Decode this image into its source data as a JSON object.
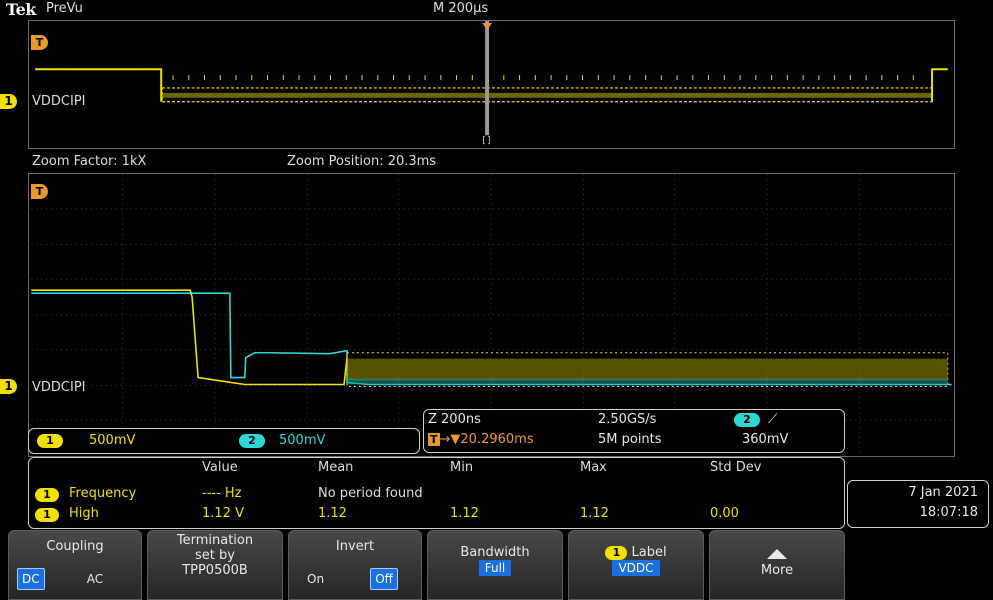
{
  "header": {
    "brand": "Tek",
    "mode": "PreVu",
    "timebase": "M 200µs"
  },
  "overview": {
    "trigger_marker": "T",
    "channel_number": "1",
    "channel_label": "VDDCIPI",
    "zoom_box_marker": "[]"
  },
  "zoom_info": {
    "factor": "Zoom Factor: 1kX",
    "position": "Zoom Position: 20.3ms"
  },
  "zoom_window": {
    "trigger_marker": "T",
    "channel_number": "1",
    "channel_label": "VDDCIPI"
  },
  "channels": {
    "ch1_num": "1",
    "ch1_scale": "500mV",
    "ch2_num": "2",
    "ch2_scale": "500mV"
  },
  "acquisition": {
    "zoom_time": "Z 200ns",
    "sample_rate": "2.50GS/s",
    "trig_channel": "2",
    "trig_slope": "⟋",
    "trig_marker": "T",
    "trig_arrow": "→▼",
    "trig_position": "20.2960ms",
    "record_length": "5M points",
    "trig_level": "360mV"
  },
  "measurements": {
    "headers": [
      "Value",
      "Mean",
      "Min",
      "Max",
      "Std Dev"
    ],
    "rows": [
      {
        "ch": "1",
        "name": "Frequency",
        "value": "---- Hz",
        "mean": "No period found",
        "min": "",
        "max": "",
        "std": ""
      },
      {
        "ch": "1",
        "name": "High",
        "value": "1.12 V",
        "mean": "1.12",
        "min": "1.12",
        "max": "1.12",
        "std": "0.00"
      }
    ]
  },
  "datetime": {
    "date": "7 Jan  2021",
    "time": "18:07:18"
  },
  "menu": {
    "coupling": {
      "label": "Coupling",
      "opt_a": "DC",
      "opt_b": "AC"
    },
    "termination": {
      "line1": "Termination",
      "line2": "set by",
      "line3": "TPP0500B"
    },
    "invert": {
      "label": "Invert",
      "opt_a": "On",
      "opt_b": "Off"
    },
    "bandwidth": {
      "label": "Bandwidth",
      "value": "Full"
    },
    "label_btn": {
      "ch": "1",
      "label": "Label",
      "value": "VDDC"
    },
    "more": {
      "label": "More"
    }
  },
  "colors": {
    "ch1": "#f0e100",
    "ch2": "#2fd7d7",
    "selection": "#1c6fe0"
  }
}
